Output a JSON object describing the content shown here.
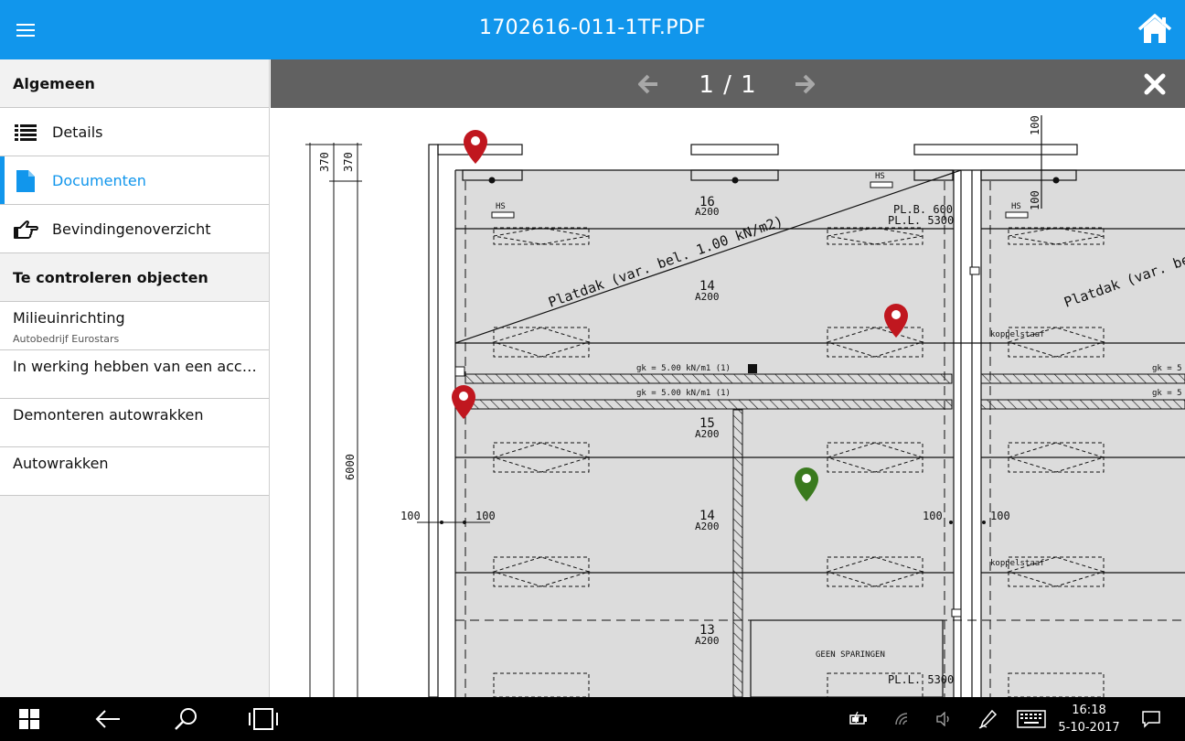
{
  "theme": {
    "accent": "#1196ec",
    "pin_red": "#c0171f",
    "pin_green": "#3a7a1e"
  },
  "header": {
    "title": "1702616-011-1TF.PDF",
    "menu_icon": "hamburger-icon",
    "home_icon": "home-icon"
  },
  "sidebar": {
    "section_general": "Algemeen",
    "nav": [
      {
        "label": "Details",
        "icon": "list-icon",
        "active": false
      },
      {
        "label": "Documenten",
        "icon": "document-icon",
        "active": true
      },
      {
        "label": "Bevindingenoverzicht",
        "icon": "pointing-hand-icon",
        "active": false
      }
    ],
    "section_objects": "Te controleren objecten",
    "objects": [
      {
        "title": "Milieuinrichting",
        "subtitle": "Autobedrijf Eurostars"
      },
      {
        "title": "In werking hebben van een accula...",
        "subtitle": ""
      },
      {
        "title": "Demonteren autowrakken",
        "subtitle": ""
      },
      {
        "title": "Autowrakken",
        "subtitle": ""
      }
    ]
  },
  "viewer": {
    "page_indicator": "1 / 1",
    "prev_icon": "arrow-left-icon",
    "next_icon": "arrow-right-icon",
    "close_icon": "close-icon"
  },
  "drawing": {
    "dims": {
      "d370a": "370",
      "d370b": "370",
      "d6000": "6000",
      "d100_top": "100",
      "d100_top2": "100",
      "d100_left_out": "100",
      "d100_left_in": "100",
      "d100_right_a": "100",
      "d100_right_b": "100"
    },
    "floors": [
      {
        "num": "16",
        "type": "A200"
      },
      {
        "num": "14",
        "type": "A200"
      },
      {
        "num": "15",
        "type": "A200"
      },
      {
        "num": "14",
        "type": "A200"
      },
      {
        "num": "13",
        "type": "A200"
      }
    ],
    "roof_label": "Platdak (var. bel. 1.00 kN/m2)",
    "roof_label_right": "Platdak (var. bel.",
    "plb": "PL.B. 600",
    "pll": "PL.L. 5300",
    "pll_bottom": "PL.L. 5300",
    "hs": "HS",
    "gk1": "gk = 5.00 kN/m1 (1)",
    "gk2": "gk = 5.00 kN/m1 (1)",
    "gk_r1": "gk = 5",
    "gk_r2": "gk = 5",
    "koppelstaaf1": "koppelstaaf",
    "koppelstaaf2": "koppelstaaf",
    "geen_sparingen": "GEEN SPARINGEN"
  },
  "taskbar": {
    "start_icon": "windows-start-icon",
    "back_icon": "back-arrow-icon",
    "search_icon": "search-icon",
    "taskview_icon": "task-view-icon",
    "tray": [
      "battery-charging-icon",
      "wifi-icon",
      "volume-icon",
      "pen-icon",
      "keyboard-icon"
    ],
    "time": "16:18",
    "date": "5-10-2017",
    "notifications_icon": "action-center-icon"
  }
}
